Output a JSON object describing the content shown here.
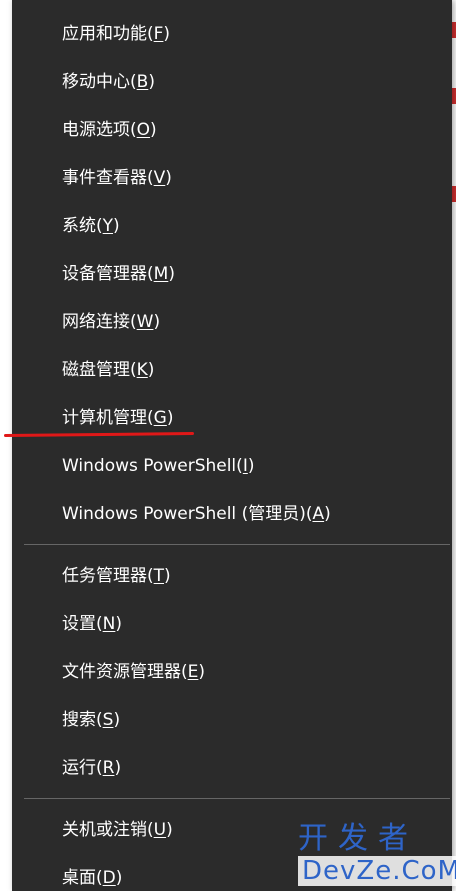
{
  "menu": {
    "group1": [
      {
        "label": "应用和功能",
        "key": "F"
      },
      {
        "label": "移动中心",
        "key": "B"
      },
      {
        "label": "电源选项",
        "key": "O"
      },
      {
        "label": "事件查看器",
        "key": "V"
      },
      {
        "label": "系统",
        "key": "Y"
      },
      {
        "label": "设备管理器",
        "key": "M"
      },
      {
        "label": "网络连接",
        "key": "W"
      },
      {
        "label": "磁盘管理",
        "key": "K"
      },
      {
        "label": "计算机管理",
        "key": "G"
      },
      {
        "label": "Windows PowerShell",
        "key": "I"
      },
      {
        "label": "Windows PowerShell (管理员)",
        "key": "A"
      }
    ],
    "group2": [
      {
        "label": "任务管理器",
        "key": "T"
      },
      {
        "label": "设置",
        "key": "N"
      },
      {
        "label": "文件资源管理器",
        "key": "E"
      },
      {
        "label": "搜索",
        "key": "S"
      },
      {
        "label": "运行",
        "key": "R"
      }
    ],
    "group3": [
      {
        "label": "关机或注销",
        "key": "U"
      },
      {
        "label": "桌面",
        "key": "D"
      }
    ]
  },
  "watermark": {
    "cn": "开发者",
    "en": "DevZe.CoM"
  },
  "colors": {
    "menu_bg": "#2b2b2b",
    "text": "#ffffff",
    "separator": "#666666",
    "annotation_red": "#e01818",
    "watermark_blue": "#2e64c8"
  }
}
